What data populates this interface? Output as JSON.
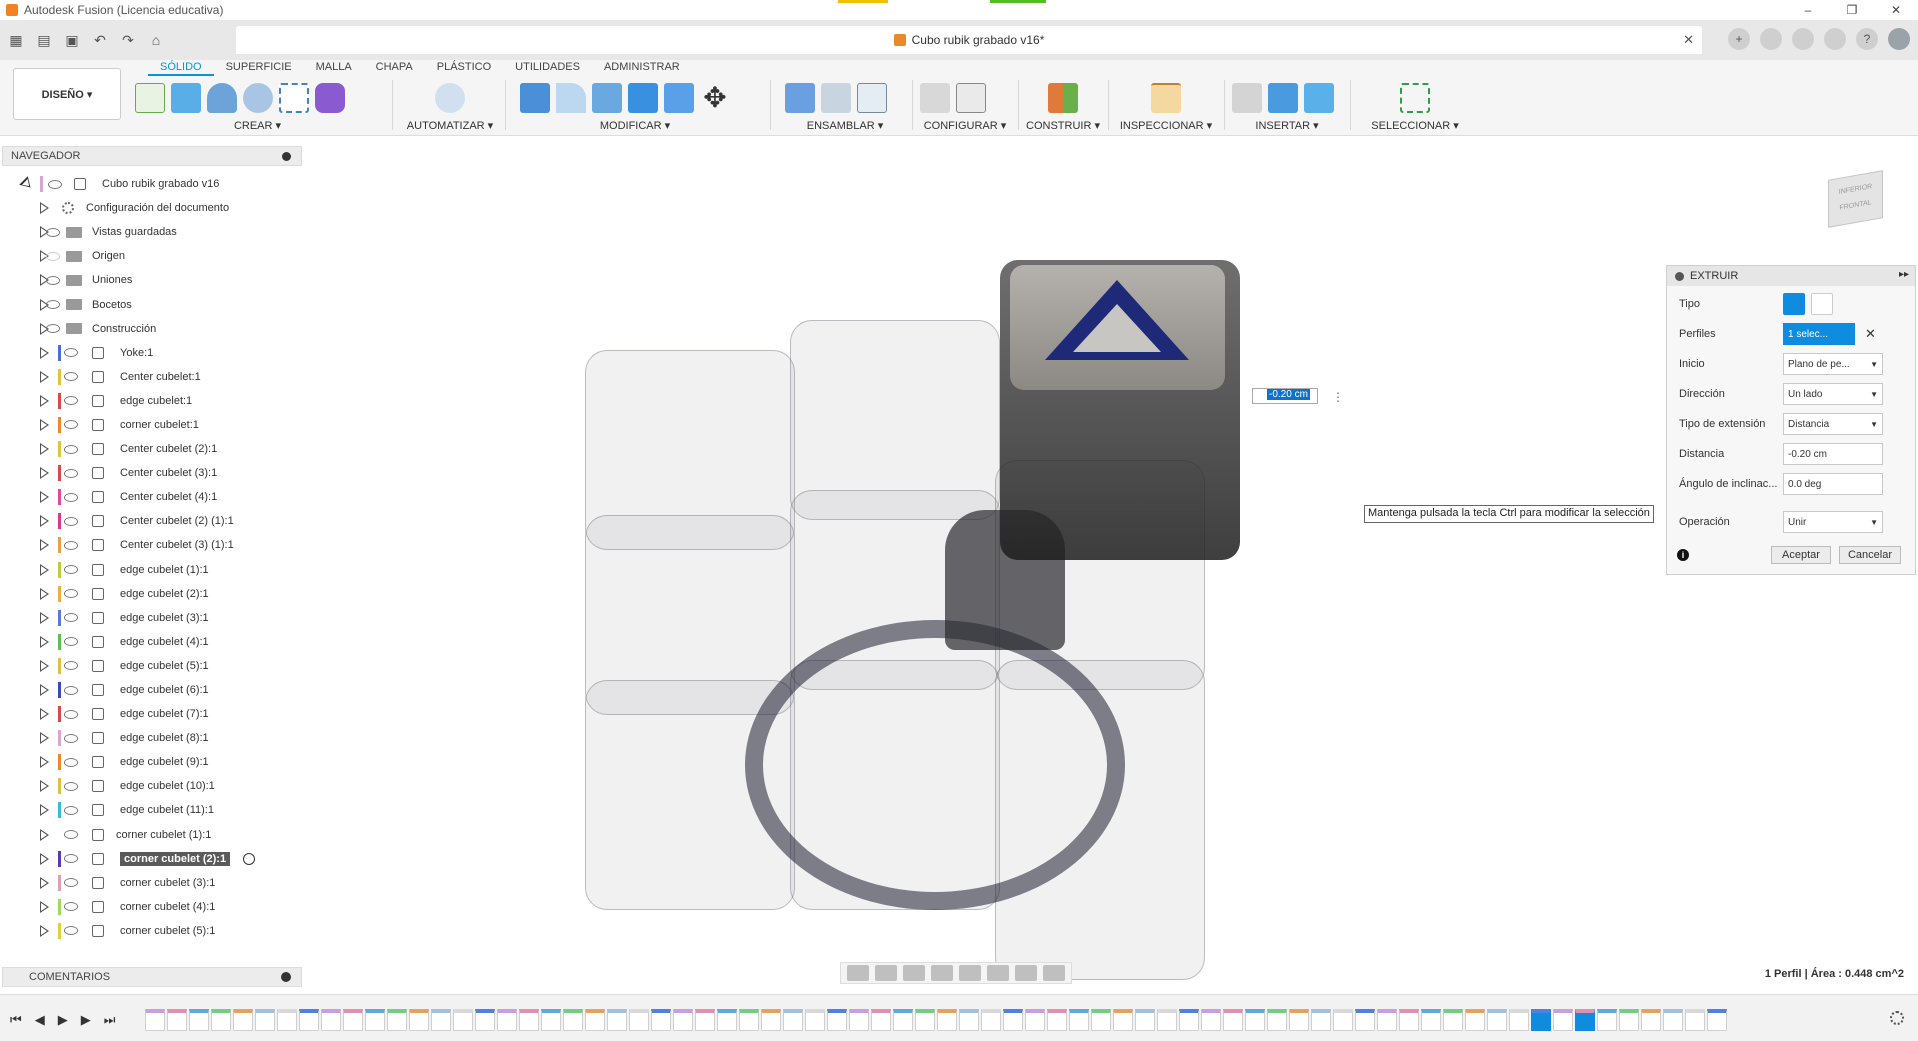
{
  "window": {
    "title": "Autodesk Fusion (Licencia educativa)",
    "controls": [
      "–",
      "❐",
      "✕"
    ]
  },
  "document": {
    "tab_title": "Cubo rubik grabado v16*"
  },
  "ribbon": {
    "workspace": "DISEÑO ▾",
    "tabs": [
      "SÓLIDO",
      "SUPERFICIE",
      "MALLA",
      "CHAPA",
      "PLÁSTICO",
      "UTILIDADES",
      "ADMINISTRAR"
    ],
    "active_tab": "SÓLIDO",
    "groups": [
      "CREAR ▾",
      "AUTOMATIZAR ▾",
      "MODIFICAR ▾",
      "ENSAMBLAR ▾",
      "CONFIGURAR ▾",
      "CONSTRUIR ▾",
      "INSPECCIONAR ▾",
      "INSERTAR ▾",
      "SELECCIONAR ▾"
    ]
  },
  "browser": {
    "title": "NAVEGADOR",
    "root": "Cubo rubik grabado v16",
    "items": [
      {
        "label": "Configuración del documento",
        "kind": "gear",
        "color": ""
      },
      {
        "label": "Vistas guardadas",
        "kind": "folder",
        "color": ""
      },
      {
        "label": "Origen",
        "kind": "folder",
        "color": "",
        "eye": "dim"
      },
      {
        "label": "Uniones",
        "kind": "folder",
        "color": ""
      },
      {
        "label": "Bocetos",
        "kind": "folder",
        "color": ""
      },
      {
        "label": "Construcción",
        "kind": "folder",
        "color": ""
      },
      {
        "label": "Yoke:1",
        "kind": "comp",
        "color": "#4a6fd8"
      },
      {
        "label": "Center cubelet:1",
        "kind": "comp",
        "color": "#e2c43c"
      },
      {
        "label": "edge cubelet:1",
        "kind": "comp",
        "color": "#d84a4a"
      },
      {
        "label": "corner cubelet:1",
        "kind": "comp",
        "color": "#e88a2c"
      },
      {
        "label": "Center cubelet (2):1",
        "kind": "comp",
        "color": "#e2c43c"
      },
      {
        "label": "Center cubelet (3):1",
        "kind": "comp",
        "color": "#d84a4a"
      },
      {
        "label": "Center cubelet (4):1",
        "kind": "comp",
        "color": "#e04a9a"
      },
      {
        "label": "Center cubelet (2) (1):1",
        "kind": "comp",
        "color": "#d83a8a"
      },
      {
        "label": "Center cubelet (3) (1):1",
        "kind": "comp",
        "color": "#e8a04a"
      },
      {
        "label": "edge cubelet (1):1",
        "kind": "comp",
        "color": "#b8d040"
      },
      {
        "label": "edge cubelet (2):1",
        "kind": "comp",
        "color": "#e8b040"
      },
      {
        "label": "edge cubelet (3):1",
        "kind": "comp",
        "color": "#5a7ad8"
      },
      {
        "label": "edge cubelet (4):1",
        "kind": "comp",
        "color": "#5ac050"
      },
      {
        "label": "edge cubelet (5):1",
        "kind": "comp",
        "color": "#e0c040"
      },
      {
        "label": "edge cubelet (6):1",
        "kind": "comp",
        "color": "#3a4ab8"
      },
      {
        "label": "edge cubelet (7):1",
        "kind": "comp",
        "color": "#d84a4a"
      },
      {
        "label": "edge cubelet (8):1",
        "kind": "comp",
        "color": "#d8a8d0"
      },
      {
        "label": "edge cubelet (9):1",
        "kind": "comp",
        "color": "#e88a2c"
      },
      {
        "label": "edge cubelet (10):1",
        "kind": "comp",
        "color": "#e0c040"
      },
      {
        "label": "edge cubelet (11):1",
        "kind": "comp",
        "color": "#3ab8e0"
      },
      {
        "label": "corner cubelet (1):1",
        "kind": "comp",
        "color": ""
      },
      {
        "label": "corner cubelet (2):1",
        "kind": "comp",
        "color": "#5a3ab0",
        "highlight": true
      },
      {
        "label": "corner cubelet (3):1",
        "kind": "comp",
        "color": "#e0a0b0"
      },
      {
        "label": "corner cubelet (4):1",
        "kind": "comp",
        "color": "#a0d860"
      },
      {
        "label": "corner cubelet (5):1",
        "kind": "comp",
        "color": "#e0d040"
      }
    ]
  },
  "comments": {
    "title": "COMENTARIOS"
  },
  "viewport": {
    "dimension_value": "-0.20 cm",
    "tooltip": "Mantenga pulsada la tecla Ctrl para modificar la selección",
    "viewcube_top": "INFERIOR",
    "viewcube_front": "FRONTAL",
    "status": "1 Perfil | Área : 0.448 cm^2"
  },
  "extrude_dialog": {
    "title": "EXTRUIR",
    "fields": {
      "tipo_label": "Tipo",
      "perfiles_label": "Perfiles",
      "perfiles_value": "1 selec...",
      "inicio_label": "Inicio",
      "inicio_value": "Plano de pe...",
      "direccion_label": "Dirección",
      "direccion_value": "Un lado",
      "tipo_ext_label": "Tipo de extensión",
      "tipo_ext_value": "Distancia",
      "distancia_label": "Distancia",
      "distancia_value": "-0.20 cm",
      "angulo_label": "Ángulo de inclinac...",
      "angulo_value": "0.0 deg",
      "operacion_label": "Operación",
      "operacion_value": "Unir"
    },
    "ok": "Aceptar",
    "cancel": "Cancelar"
  }
}
